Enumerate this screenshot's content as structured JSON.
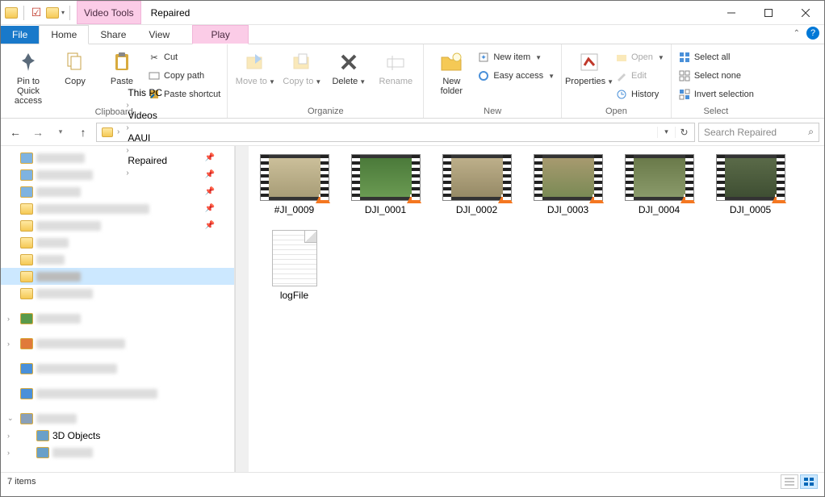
{
  "title": "Repaired",
  "contextual_tab": "Video Tools",
  "tabs": {
    "file": "File",
    "home": "Home",
    "share": "Share",
    "view": "View",
    "play": "Play"
  },
  "ribbon": {
    "clipboard": {
      "label": "Clipboard",
      "pin": "Pin to Quick access",
      "copy": "Copy",
      "paste": "Paste",
      "cut": "Cut",
      "copy_path": "Copy path",
      "paste_shortcut": "Paste shortcut"
    },
    "organize": {
      "label": "Organize",
      "move_to": "Move to",
      "copy_to": "Copy to",
      "delete": "Delete",
      "rename": "Rename"
    },
    "new": {
      "label": "New",
      "new_folder": "New folder",
      "new_item": "New item",
      "easy_access": "Easy access"
    },
    "open": {
      "label": "Open",
      "properties": "Properties",
      "open": "Open",
      "edit": "Edit",
      "history": "History"
    },
    "select": {
      "label": "Select",
      "select_all": "Select all",
      "select_none": "Select none",
      "invert": "Invert selection"
    }
  },
  "breadcrumb": [
    "This PC",
    "Videos",
    "AAUI",
    "Repaired"
  ],
  "search_placeholder": "Search Repaired",
  "files": [
    {
      "name": "#JI_0009",
      "bg": "linear-gradient(#cbbf9a,#a89d77)"
    },
    {
      "name": "DJI_0001",
      "bg": "linear-gradient(#4b7a3a,#6a9a52)"
    },
    {
      "name": "DJI_0002",
      "bg": "linear-gradient(#bdaf8a,#968a66)"
    },
    {
      "name": "DJI_0003",
      "bg": "linear-gradient(#a79a6f,#7a8a55)"
    },
    {
      "name": "DJI_0004",
      "bg": "linear-gradient(#6a7a4a,#8a9a6a)"
    },
    {
      "name": "DJI_0005",
      "bg": "linear-gradient(#5a6a48,#3f4f33)"
    }
  ],
  "log_file": "logFile",
  "tree_extra": "3D Objects",
  "status_text": "7 items"
}
